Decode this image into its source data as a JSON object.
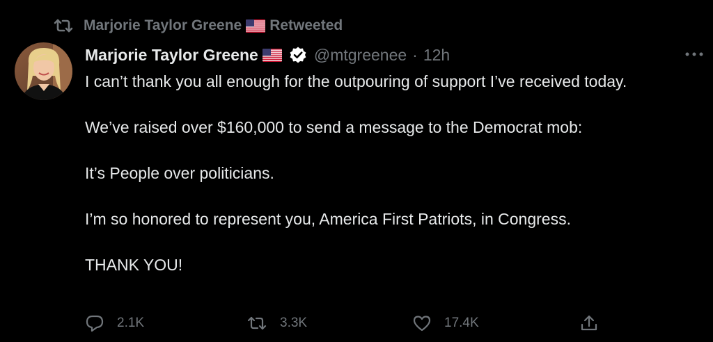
{
  "colors": {
    "background": "#000000",
    "text": "#e7e9ea",
    "secondary": "#71767b",
    "verified_badge": "#ffffff"
  },
  "retweet_notice": {
    "name": "Marjorie Taylor Greene",
    "label": "Retweeted",
    "icon": "retweet-icon",
    "emoji": "us-flag"
  },
  "tweet": {
    "author_name": "Marjorie Taylor Greene",
    "author_emoji": "us-flag",
    "verified_icon": "verified-badge-icon",
    "handle": "@mtgreenee",
    "separator": "·",
    "time": "12h",
    "more_icon": "more-icon",
    "text_lines": [
      "I can’t thank you all enough for the outpouring of support I’ve received today.",
      "We’ve raised over $160,000 to send a message to the Democrat mob:",
      "It’s People over politicians.",
      "I’m so honored to represent you, America First Patriots, in Congress.",
      "THANK YOU!"
    ]
  },
  "actions": {
    "reply": {
      "icon": "reply-icon",
      "count": "2.1K"
    },
    "retweet": {
      "icon": "retweet-icon",
      "count": "3.3K"
    },
    "like": {
      "icon": "like-icon",
      "count": "17.4K"
    },
    "share": {
      "icon": "share-icon"
    }
  }
}
